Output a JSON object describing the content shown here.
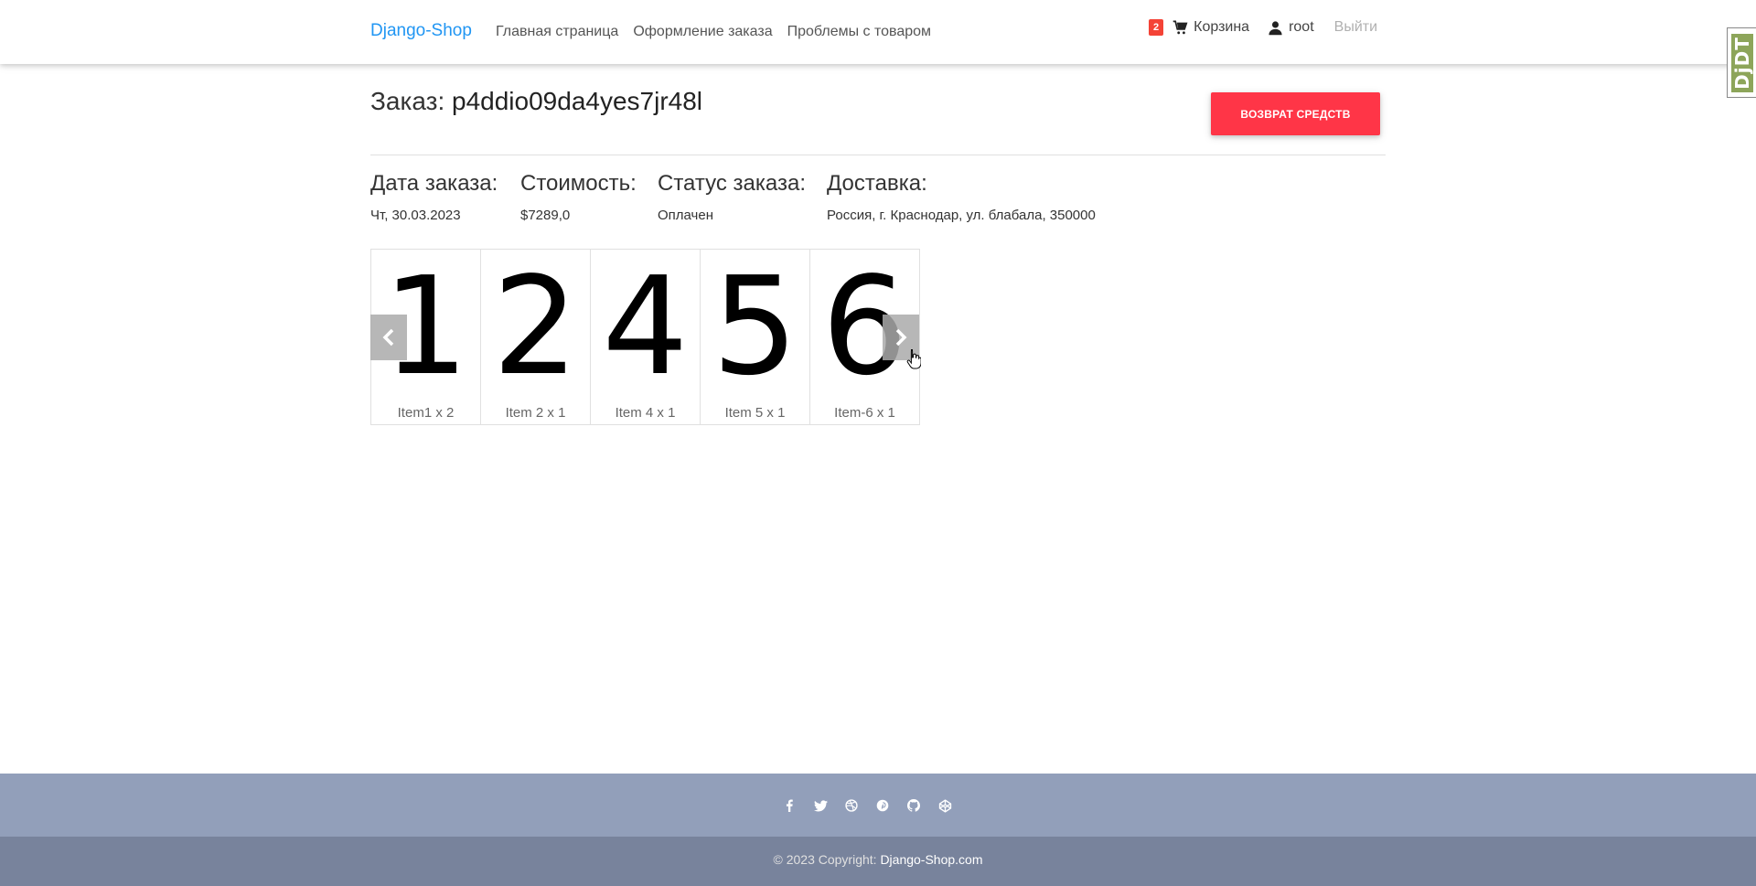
{
  "navbar": {
    "brand": "Django-Shop",
    "links": [
      "Главная страница",
      "Оформление заказа",
      "Проблемы с товаром"
    ],
    "cart_badge": "2",
    "cart_label": "Корзина",
    "user_label": "root",
    "logout_label": "Выйти"
  },
  "debug_toolbar": {
    "label": "DjDT"
  },
  "order": {
    "title_prefix": "Заказ:",
    "code": "p4ddio09da4yes7jr48l",
    "refund_button": "ВОЗВРАТ СРЕДСТВ",
    "date_label": "Дата заказа:",
    "date_value": "Чт, 30.03.2023",
    "cost_label": "Стоимость:",
    "cost_value": "$7289,0",
    "status_label": "Статус заказа:",
    "status_value": "Оплачен",
    "delivery_label": "Доставка:",
    "delivery_value": "Россия, г. Краснодар, ул. блабала, 350000"
  },
  "carousel": {
    "items": [
      {
        "image_text": "1",
        "caption": "Item1 x 2"
      },
      {
        "image_text": "2",
        "caption": "Item 2 x 1"
      },
      {
        "image_text": "4",
        "caption": "Item 4 x 1"
      },
      {
        "image_text": "5",
        "caption": "Item 5 x 1"
      },
      {
        "image_text": "6",
        "caption": "Item-6 x 1"
      }
    ],
    "prev_icon": "chevron-left-icon",
    "next_icon": "chevron-right-icon"
  },
  "footer": {
    "social_icons": [
      "facebook-icon",
      "twitter-icon",
      "dribbble-icon",
      "pinterest-icon",
      "github-icon",
      "codepen-icon"
    ],
    "copyright_prefix": "© 2023 Copyright:",
    "copyright_link": "Django-Shop.com"
  },
  "colors": {
    "brand": "#2196f3",
    "refund_button": "#ff3547",
    "badge": "#f44336",
    "footer_top": "#929fba",
    "footer_bottom": "#78839c"
  }
}
